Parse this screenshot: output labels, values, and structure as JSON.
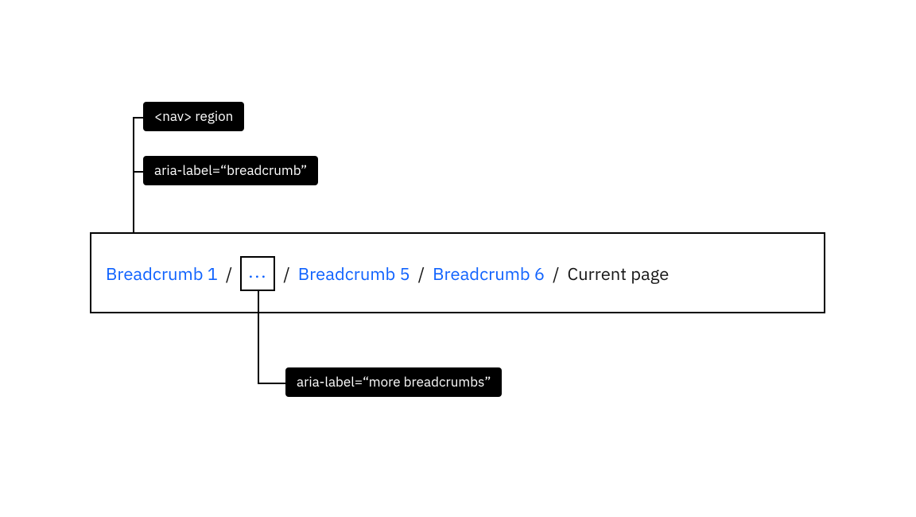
{
  "annotations": {
    "nav_region": "<nav> region",
    "aria_breadcrumb": "aria-label=“breadcrumb”",
    "aria_more": "aria-label=“more breadcrumbs”"
  },
  "breadcrumb": {
    "items": {
      "b1": "Breadcrumb 1",
      "overflow": "...",
      "b5": "Breadcrumb 5",
      "b6": "Breadcrumb 6",
      "current": "Current page"
    },
    "separator": "/"
  }
}
